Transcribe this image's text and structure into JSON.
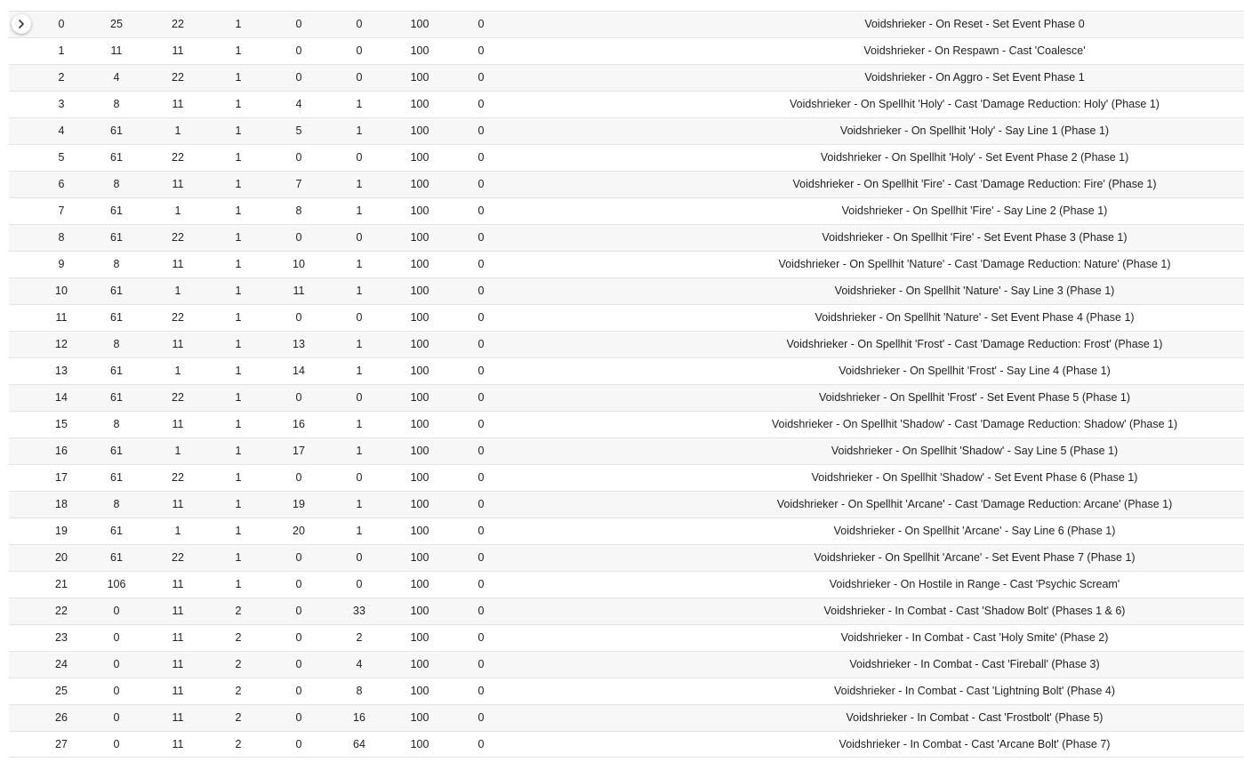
{
  "table": {
    "rows": [
      [
        "0",
        "25",
        "22",
        "1",
        "0",
        "0",
        "100",
        "0",
        "Voidshrieker - On Reset - Set Event Phase 0"
      ],
      [
        "1",
        "11",
        "11",
        "1",
        "0",
        "0",
        "100",
        "0",
        "Voidshrieker - On Respawn - Cast 'Coalesce'"
      ],
      [
        "2",
        "4",
        "22",
        "1",
        "0",
        "0",
        "100",
        "0",
        "Voidshrieker - On Aggro - Set Event Phase 1"
      ],
      [
        "3",
        "8",
        "11",
        "1",
        "4",
        "1",
        "100",
        "0",
        "Voidshrieker - On Spellhit 'Holy' - Cast 'Damage Reduction: Holy' (Phase 1)"
      ],
      [
        "4",
        "61",
        "1",
        "1",
        "5",
        "1",
        "100",
        "0",
        "Voidshrieker - On Spellhit 'Holy' - Say Line 1 (Phase 1)"
      ],
      [
        "5",
        "61",
        "22",
        "1",
        "0",
        "0",
        "100",
        "0",
        "Voidshrieker - On Spellhit 'Holy' - Set Event Phase 2 (Phase 1)"
      ],
      [
        "6",
        "8",
        "11",
        "1",
        "7",
        "1",
        "100",
        "0",
        "Voidshrieker - On Spellhit 'Fire' - Cast 'Damage Reduction: Fire' (Phase 1)"
      ],
      [
        "7",
        "61",
        "1",
        "1",
        "8",
        "1",
        "100",
        "0",
        "Voidshrieker - On Spellhit 'Fire' - Say Line 2 (Phase 1)"
      ],
      [
        "8",
        "61",
        "22",
        "1",
        "0",
        "0",
        "100",
        "0",
        "Voidshrieker - On Spellhit 'Fire' - Set Event Phase 3 (Phase 1)"
      ],
      [
        "9",
        "8",
        "11",
        "1",
        "10",
        "1",
        "100",
        "0",
        "Voidshrieker - On Spellhit 'Nature' - Cast 'Damage Reduction: Nature' (Phase 1)"
      ],
      [
        "10",
        "61",
        "1",
        "1",
        "11",
        "1",
        "100",
        "0",
        "Voidshrieker - On Spellhit 'Nature' - Say Line 3 (Phase 1)"
      ],
      [
        "11",
        "61",
        "22",
        "1",
        "0",
        "0",
        "100",
        "0",
        "Voidshrieker - On Spellhit 'Nature' - Set Event Phase 4 (Phase 1)"
      ],
      [
        "12",
        "8",
        "11",
        "1",
        "13",
        "1",
        "100",
        "0",
        "Voidshrieker - On Spellhit 'Frost' - Cast 'Damage Reduction: Frost' (Phase 1)"
      ],
      [
        "13",
        "61",
        "1",
        "1",
        "14",
        "1",
        "100",
        "0",
        "Voidshrieker - On Spellhit 'Frost' - Say Line 4 (Phase 1)"
      ],
      [
        "14",
        "61",
        "22",
        "1",
        "0",
        "0",
        "100",
        "0",
        "Voidshrieker - On Spellhit 'Frost' - Set Event Phase 5 (Phase 1)"
      ],
      [
        "15",
        "8",
        "11",
        "1",
        "16",
        "1",
        "100",
        "0",
        "Voidshrieker - On Spellhit 'Shadow' - Cast 'Damage Reduction: Shadow' (Phase 1)"
      ],
      [
        "16",
        "61",
        "1",
        "1",
        "17",
        "1",
        "100",
        "0",
        "Voidshrieker - On Spellhit 'Shadow' - Say Line 5 (Phase 1)"
      ],
      [
        "17",
        "61",
        "22",
        "1",
        "0",
        "0",
        "100",
        "0",
        "Voidshrieker - On Spellhit 'Shadow' - Set Event Phase 6 (Phase 1)"
      ],
      [
        "18",
        "8",
        "11",
        "1",
        "19",
        "1",
        "100",
        "0",
        "Voidshrieker - On Spellhit 'Arcane' - Cast 'Damage Reduction: Arcane' (Phase 1)"
      ],
      [
        "19",
        "61",
        "1",
        "1",
        "20",
        "1",
        "100",
        "0",
        "Voidshrieker - On Spellhit 'Arcane' - Say Line 6 (Phase 1)"
      ],
      [
        "20",
        "61",
        "22",
        "1",
        "0",
        "0",
        "100",
        "0",
        "Voidshrieker - On Spellhit 'Arcane' - Set Event Phase 7 (Phase 1)"
      ],
      [
        "21",
        "106",
        "11",
        "1",
        "0",
        "0",
        "100",
        "0",
        "Voidshrieker - On Hostile in Range - Cast 'Psychic Scream'"
      ],
      [
        "22",
        "0",
        "11",
        "2",
        "0",
        "33",
        "100",
        "0",
        "Voidshrieker - In Combat - Cast 'Shadow Bolt' (Phases 1 & 6)"
      ],
      [
        "23",
        "0",
        "11",
        "2",
        "0",
        "2",
        "100",
        "0",
        "Voidshrieker - In Combat - Cast 'Holy Smite' (Phase 2)"
      ],
      [
        "24",
        "0",
        "11",
        "2",
        "0",
        "4",
        "100",
        "0",
        "Voidshrieker - In Combat - Cast 'Fireball' (Phase 3)"
      ],
      [
        "25",
        "0",
        "11",
        "2",
        "0",
        "8",
        "100",
        "0",
        "Voidshrieker - In Combat - Cast 'Lightning Bolt' (Phase 4)"
      ],
      [
        "26",
        "0",
        "11",
        "2",
        "0",
        "16",
        "100",
        "0",
        "Voidshrieker - In Combat - Cast 'Frostbolt' (Phase 5)"
      ],
      [
        "27",
        "0",
        "11",
        "2",
        "0",
        "64",
        "100",
        "0",
        "Voidshrieker - In Combat - Cast 'Arcane Bolt' (Phase 7)"
      ]
    ]
  },
  "expand_button": {
    "icon": "chevron-right-icon"
  }
}
